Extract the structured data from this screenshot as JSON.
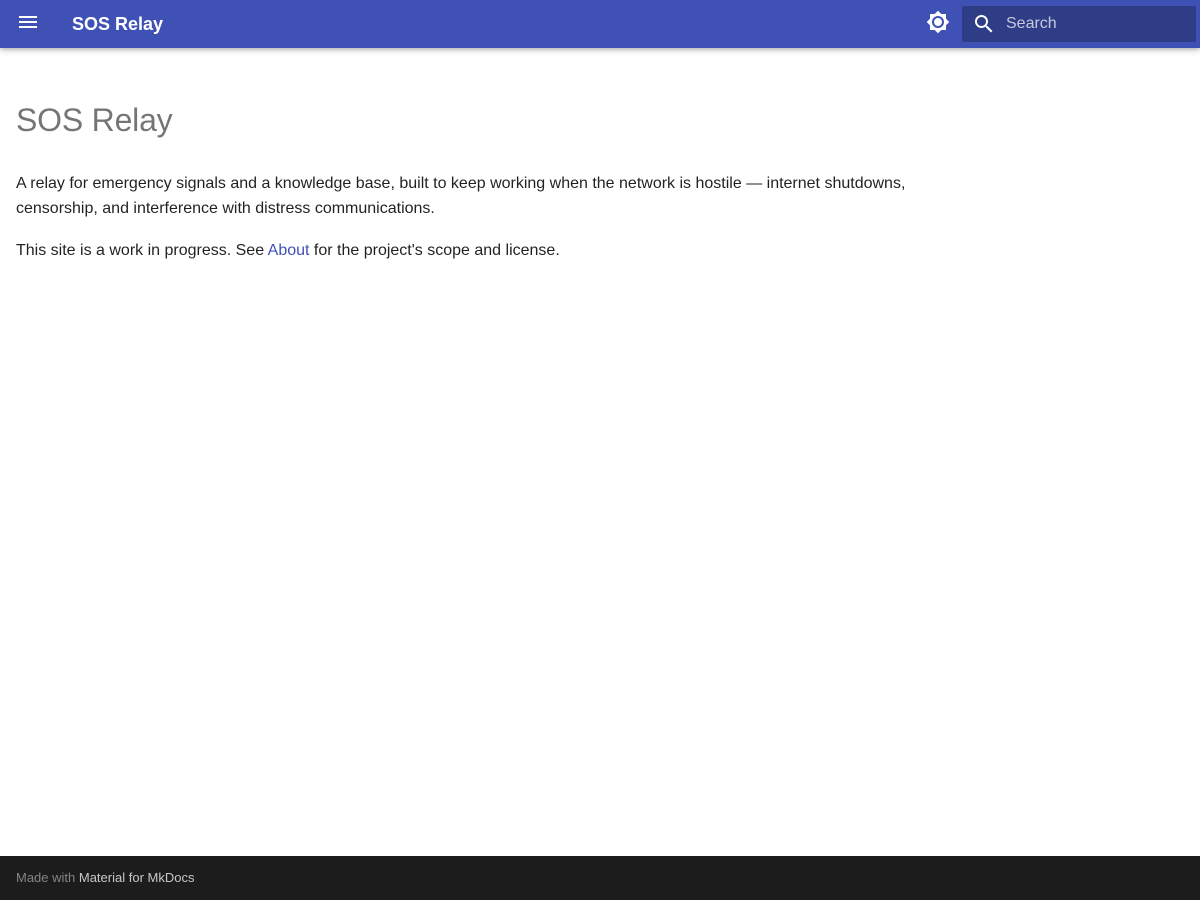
{
  "header": {
    "site_title": "SOS Relay",
    "background_color": "#4051b5",
    "menu_icon": "menu-icon",
    "theme_icon": "brightness-icon",
    "search": {
      "placeholder": "Search",
      "value": "",
      "icon": "search-icon"
    }
  },
  "main": {
    "title": "SOS Relay",
    "paragraph1": "A relay for emergency signals and a knowledge base, built to keep working when the network is hostile — internet shutdowns, censorship, and interference with distress communications.",
    "paragraph2": {
      "before": "This site is a work in progress. See ",
      "link": "About",
      "after": " for the project's scope and license."
    },
    "link_color": "#4051b5"
  },
  "footer": {
    "prefix": "Made with ",
    "link": "Material for MkDocs",
    "background_color": "#1c1c1c"
  }
}
